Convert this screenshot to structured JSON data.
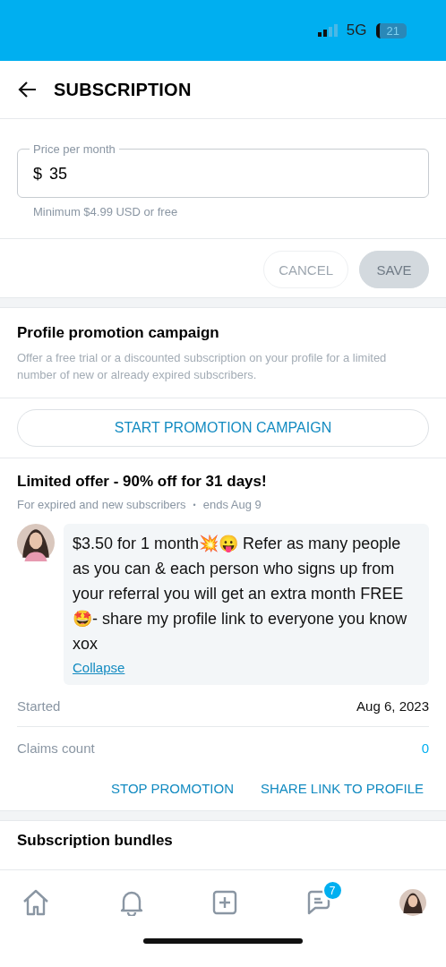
{
  "status_bar": {
    "network": "5G",
    "battery": "21"
  },
  "header": {
    "title": "SUBSCRIPTION"
  },
  "price": {
    "label": "Price per month",
    "currency": "$",
    "value": "35",
    "hint": "Minimum $4.99 USD or free"
  },
  "actions": [
    {
      "label": "CANCEL",
      "kind": "outline",
      "disabled": true
    },
    {
      "label": "SAVE",
      "kind": "filled",
      "disabled": true
    }
  ],
  "promotion": {
    "title": "Profile promotion campaign",
    "description": "Offer a free trial or a discounted subscription on your profile for a limited number of new or already expired subscribers.",
    "button": "START PROMOTION CAMPAIGN"
  },
  "offer": {
    "title": "Limited offer - 90% off for 31 days!",
    "audience": "For expired and new subscribers",
    "separator": "•",
    "ends": "ends Aug 9",
    "message": "$3.50 for 1 month💥😛 Refer as many people as you can & each person who signs up from your referral you will get an extra month FREE 🤩- share my profile link to everyone you know xox",
    "collapse": "Collapse",
    "details": [
      {
        "label": "Started",
        "value": "Aug 6, 2023",
        "kind": "plain"
      },
      {
        "label": "Claims count",
        "value": "0",
        "kind": "link"
      }
    ],
    "buttons": [
      "STOP PROMOTION",
      "SHARE LINK TO PROFILE"
    ]
  },
  "bundles": {
    "title": "Subscription bundles"
  },
  "nav": [
    {
      "kind": "home"
    },
    {
      "kind": "bell"
    },
    {
      "kind": "add"
    },
    {
      "kind": "chat",
      "badge": "7"
    },
    {
      "kind": "avatar"
    }
  ]
}
